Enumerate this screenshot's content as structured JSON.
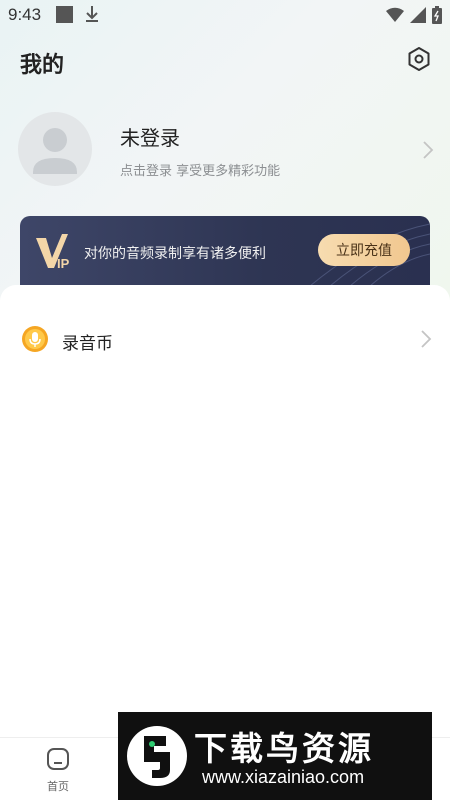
{
  "status_bar": {
    "time": "9:43"
  },
  "header": {
    "title": "我的"
  },
  "profile": {
    "title": "未登录",
    "subtitle": "点击登录 享受更多精彩功能"
  },
  "vip": {
    "logo_text": "VIP",
    "text": "对你的音频录制享有诸多便利",
    "button_label": "立即充值"
  },
  "menu": {
    "items": [
      {
        "label": "录音币",
        "icon": "microphone-coin-icon"
      }
    ]
  },
  "bottom_nav": {
    "items": [
      {
        "label": "首页",
        "icon": "home-icon"
      }
    ]
  },
  "watermark": {
    "title": "下载鸟资源",
    "url": "www.xiazainiao.com"
  },
  "colors": {
    "vip_bg": "#2e3553",
    "vip_button": "#f1c78f",
    "coin": "#f5a623"
  }
}
